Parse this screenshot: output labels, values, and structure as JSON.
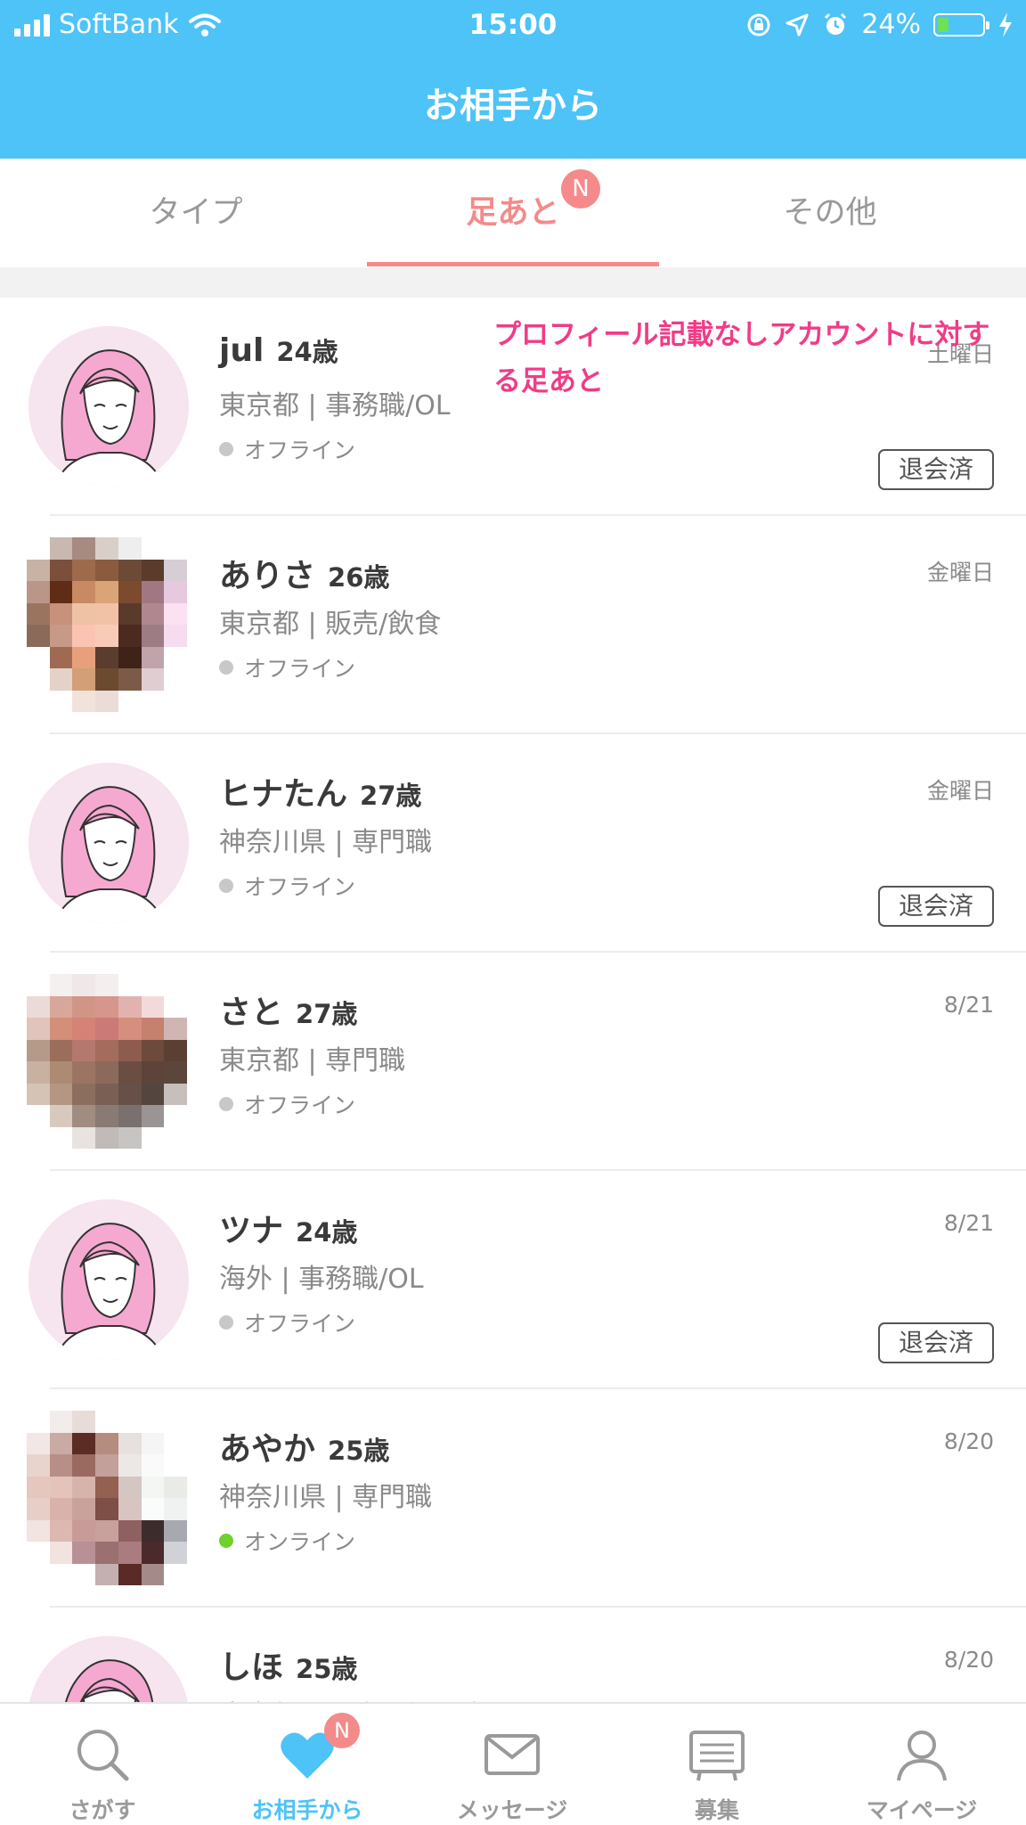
{
  "status_bar": {
    "carrier": "SoftBank",
    "time": "15:00",
    "battery_percent": "24%",
    "battery_level": 0.24
  },
  "header": {
    "title": "お相手から"
  },
  "tabs": [
    {
      "label": "タイプ",
      "active": false
    },
    {
      "label": "足あと",
      "active": true,
      "badge": "N"
    },
    {
      "label": "その他",
      "active": false
    }
  ],
  "annotation": "プロフィール記載なしアカウントに対する足あと",
  "footprints": [
    {
      "name": "jul",
      "age": "24歳",
      "info": "東京都 | 事務職/OL",
      "status": "オフライン",
      "online": false,
      "date": "土曜日",
      "withdrawn_label": "退会済",
      "avatar": "illustration"
    },
    {
      "name": "ありさ",
      "age": "26歳",
      "info": "東京都 | 販売/飲食",
      "status": "オフライン",
      "online": false,
      "date": "金曜日",
      "withdrawn_label": "",
      "avatar": "pixelated"
    },
    {
      "name": "ヒナたん",
      "age": "27歳",
      "info": "神奈川県 | 専門職",
      "status": "オフライン",
      "online": false,
      "date": "金曜日",
      "withdrawn_label": "退会済",
      "avatar": "illustration"
    },
    {
      "name": "さと",
      "age": "27歳",
      "info": "東京都 | 専門職",
      "status": "オフライン",
      "online": false,
      "date": "8/21",
      "withdrawn_label": "",
      "avatar": "pixelated"
    },
    {
      "name": "ツナ",
      "age": "24歳",
      "info": "海外 | 事務職/OL",
      "status": "オフライン",
      "online": false,
      "date": "8/21",
      "withdrawn_label": "退会済",
      "avatar": "illustration"
    },
    {
      "name": "あやか",
      "age": "25歳",
      "info": "神奈川県 | 専門職",
      "status": "オンライン",
      "online": true,
      "date": "8/20",
      "withdrawn_label": "",
      "avatar": "pixelated"
    },
    {
      "name": "しほ",
      "age": "25歳",
      "info": "東京都 | 医療関係/医師",
      "status": "",
      "online": false,
      "date": "8/20",
      "withdrawn_label": "",
      "avatar": "illustration"
    }
  ],
  "bottom_nav": [
    {
      "label": "さがす",
      "icon": "search-icon",
      "active": false
    },
    {
      "label": "お相手から",
      "icon": "heart-icon",
      "active": true,
      "badge": "N"
    },
    {
      "label": "メッセージ",
      "icon": "mail-icon",
      "active": false
    },
    {
      "label": "募集",
      "icon": "board-icon",
      "active": false
    },
    {
      "label": "マイページ",
      "icon": "person-icon",
      "active": false
    }
  ],
  "colors": {
    "header_bg": "#4dc3f7",
    "accent_pink": "#f48a8a",
    "annotation": "#f03c86",
    "online": "#6fd12c"
  }
}
